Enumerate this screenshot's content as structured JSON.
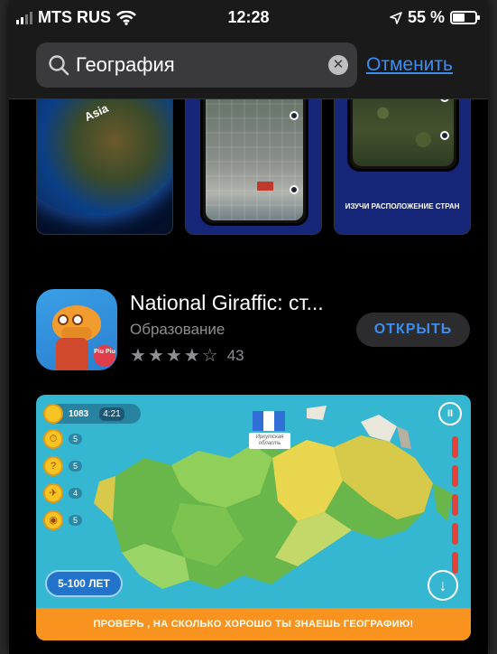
{
  "status_bar": {
    "carrier": "MTS RUS",
    "time": "12:28",
    "battery": "55 %",
    "battery_level": 0.55
  },
  "search": {
    "query": "География",
    "cancel_label": "Отменить"
  },
  "screenshots_row": {
    "shot1_label": "Asia",
    "shot3_caption": "ИЗУЧИ РАСПОЛОЖЕНИЕ СТРАН"
  },
  "app": {
    "name": "National Giraffic: ст...",
    "category": "Образование",
    "rating_stars": 4,
    "rating_max": 5,
    "rating_count": "43",
    "open_label": "ОТКРЫТЬ",
    "icon_badge": "Piu Piu"
  },
  "game_screenshot": {
    "coins": "1083",
    "timer": "4:21",
    "powerups": [
      "5",
      "5",
      "4",
      "5"
    ],
    "flag_label": "Иркутская область",
    "age_badge": "5-100 ЛЕТ",
    "banner": "ПРОВЕРЬ , НА СКОЛЬКО ХОРОШО ТЫ ЗНАЕШЬ ГЕОГРАФИЮ!"
  },
  "colors": {
    "accent": "#3b8ef0",
    "banner": "#f7931e",
    "sea": "#35b6d1"
  }
}
